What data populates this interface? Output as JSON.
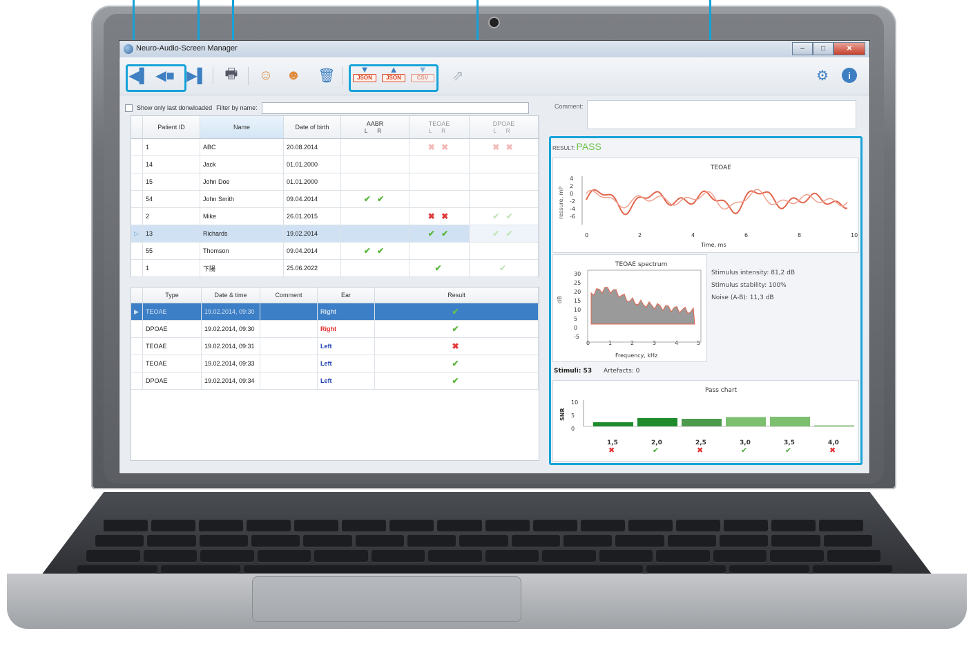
{
  "window": {
    "title": "Neuro-Audio-Screen Manager",
    "minimize": "–",
    "maximize": "□",
    "close": "✕"
  },
  "toolbar": {
    "items": [
      {
        "name": "device-disconnect-icon"
      },
      {
        "name": "download-from-device-icon"
      },
      {
        "name": "upload-to-device-icon"
      },
      {
        "name": "print-icon"
      },
      {
        "name": "add-patient-icon"
      },
      {
        "name": "edit-patient-icon"
      },
      {
        "name": "delete-icon"
      },
      {
        "name": "export-json-icon"
      },
      {
        "name": "import-json-icon"
      },
      {
        "name": "export-csv-icon"
      },
      {
        "name": "send-icon"
      },
      {
        "name": "settings-icon"
      },
      {
        "name": "info-icon"
      }
    ],
    "json_export": "JSON",
    "json_import": "JSON",
    "csv_export": "CSV",
    "accent": "#15a3d8"
  },
  "filter": {
    "show_last_label": "Show only last donwloaded",
    "filter_label": "Filter by name:",
    "filter_value": ""
  },
  "comment": {
    "label": "Comment:",
    "value": ""
  },
  "patients": {
    "headers": {
      "id": "Patient ID",
      "name": "Name",
      "dob": "Date of birth",
      "aabr": "AABR",
      "teoae": "TEOAE",
      "dpoae": "DPOAE",
      "lr": "L R"
    },
    "rows": [
      {
        "id": "1",
        "name": "ABC",
        "dob": "20.08.2014",
        "aabr": "",
        "teoae": "✖ ✖",
        "dpoae": "✖ ✖"
      },
      {
        "id": "14",
        "name": "Jack",
        "dob": "01.01.2000",
        "aabr": "",
        "teoae": "",
        "dpoae": ""
      },
      {
        "id": "15",
        "name": "John Doe",
        "dob": "01.01.2000",
        "aabr": "",
        "teoae": "",
        "dpoae": ""
      },
      {
        "id": "54",
        "name": "John Smith",
        "dob": "09.04.2014",
        "aabr": "✔ ✔",
        "teoae": "",
        "dpoae": ""
      },
      {
        "id": "2",
        "name": "Mike",
        "dob": "26.01.2015",
        "aabr": "",
        "teoae": "✖ ✖",
        "dpoae": "✔ ✔"
      },
      {
        "id": "13",
        "name": "Richards",
        "dob": "19.02.2014",
        "aabr": "",
        "teoae": "✔ ✔",
        "dpoae": "✔ ✔"
      },
      {
        "id": "55",
        "name": "Thomson",
        "dob": "09.04.2014",
        "aabr": "✔ ✔",
        "teoae": "",
        "dpoae": ""
      },
      {
        "id": "1",
        "name": "下陽",
        "dob": "25.06.2022",
        "aabr": "",
        "teoae": "✔",
        "dpoae": "✔"
      }
    ]
  },
  "tests": {
    "headers": {
      "type": "Type",
      "datetime": "Date & time",
      "comment": "Comment",
      "ear": "Ear",
      "result": "Result"
    },
    "rows": [
      {
        "type": "TEOAE",
        "datetime": "19.02.2014, 09:30",
        "comment": "",
        "ear": "Right",
        "result": "✔"
      },
      {
        "type": "DPOAE",
        "datetime": "19.02.2014, 09:30",
        "comment": "",
        "ear": "Right",
        "result": "✔"
      },
      {
        "type": "TEOAE",
        "datetime": "19.02.2014, 09:31",
        "comment": "",
        "ear": "Left",
        "result": "✖"
      },
      {
        "type": "TEOAE",
        "datetime": "19.02.2014, 09:33",
        "comment": "",
        "ear": "Left",
        "result": "✔"
      },
      {
        "type": "DPOAE",
        "datetime": "19.02.2014, 09:34",
        "comment": "",
        "ear": "Left",
        "result": "✔"
      }
    ]
  },
  "result": {
    "label": "RESULT:",
    "value": "PASS",
    "pass_color": "#6cc04a",
    "teoae": {
      "title": "TEOAE",
      "ylabel": "ressure, mP",
      "xlabel": "Time, ms",
      "yticks": [
        "4",
        "2",
        "0",
        "-2",
        "-4",
        "-6"
      ],
      "xticks": [
        "0",
        "2",
        "4",
        "6",
        "8",
        "10"
      ]
    },
    "spectrum": {
      "title": "TEOAE spectrum",
      "ylabel": "dB",
      "xlabel": "Frequency, kHz",
      "yticks": [
        "30",
        "25",
        "20",
        "15",
        "10",
        "5",
        "0",
        "-5"
      ],
      "xticks": [
        "0",
        "1",
        "2",
        "3",
        "4",
        "5"
      ]
    },
    "stats": {
      "intensity": "Stimulus intensity: 81,2 dB",
      "stability": "Stimulus stability: 100%",
      "noise": "Noise (A-B): 11,3 dB"
    },
    "stimuli": "Stimuli: 53",
    "artefacts": "Artefacts: 0",
    "pass_chart": {
      "title": "Pass chart",
      "ylabel": "SNR",
      "yticks": [
        "10",
        "5",
        "0"
      ],
      "bands": [
        {
          "freq": "1,5",
          "snr": 1.2,
          "mark": "✖",
          "pass": false
        },
        {
          "freq": "2,0",
          "snr": 2.4,
          "mark": "✔",
          "pass": true
        },
        {
          "freq": "2,5",
          "snr": 2.2,
          "mark": "✖",
          "pass": false
        },
        {
          "freq": "3,0",
          "snr": 2.7,
          "mark": "✔",
          "pass": true
        },
        {
          "freq": "3,5",
          "snr": 2.8,
          "mark": "✔",
          "pass": true
        },
        {
          "freq": "4,0",
          "snr": 0.3,
          "mark": "✖",
          "pass": false
        }
      ]
    }
  }
}
